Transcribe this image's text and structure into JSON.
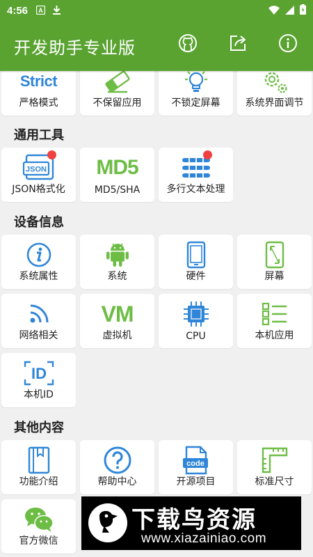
{
  "status_bar": {
    "time": "4:56",
    "left_icons": [
      "font-icon",
      "download-icon"
    ],
    "right_icons": [
      "wifi-icon",
      "signal-icon",
      "battery-icon"
    ]
  },
  "app_bar": {
    "title": "开发助手专业版",
    "actions": [
      "github-icon",
      "share-icon",
      "info-icon"
    ]
  },
  "top_row": {
    "items": [
      {
        "label": "严格模式",
        "icon_text": "Strict"
      },
      {
        "label": "不保留应用",
        "icon": "eraser-icon"
      },
      {
        "label": "不锁定屏幕",
        "icon": "bulb-icon"
      },
      {
        "label": "系统界面调节",
        "icon": "gears-icon"
      }
    ]
  },
  "general_tools": {
    "title": "通用工具",
    "items": [
      {
        "label": "JSON格式化",
        "icon_text": "JSON"
      },
      {
        "label": "MD5/SHA",
        "icon_text": "MD5"
      },
      {
        "label": "多行文本处理",
        "icon": "multiline-text-icon"
      }
    ]
  },
  "device_info": {
    "title": "设备信息",
    "items": [
      {
        "label": "系统属性",
        "icon": "info-circle-icon"
      },
      {
        "label": "系统",
        "icon": "android-icon"
      },
      {
        "label": "硬件",
        "icon": "phone-icon"
      },
      {
        "label": "屏幕",
        "icon": "screen-icon"
      },
      {
        "label": "网络相关",
        "icon": "wifi-signal-icon"
      },
      {
        "label": "虚拟机",
        "icon_text": "VM"
      },
      {
        "label": "CPU",
        "icon": "chip-icon"
      },
      {
        "label": "本机应用",
        "icon": "app-list-icon"
      },
      {
        "label": "本机ID",
        "icon_text": "ID"
      }
    ]
  },
  "other": {
    "title": "其他内容",
    "items": [
      {
        "label": "功能介绍",
        "icon": "book-icon"
      },
      {
        "label": "帮助中心",
        "icon": "help-icon"
      },
      {
        "label": "开源项目",
        "icon_text": "code"
      },
      {
        "label": "标准尺寸",
        "icon": "ruler-icon"
      },
      {
        "label": "官方微信",
        "icon": "wechat-icon"
      }
    ]
  },
  "watermark": {
    "title": "下载鸟资源",
    "url": "www.xiazainiao.com"
  },
  "colors": {
    "primary": "#5aa331",
    "blue": "#2f86d8",
    "green": "#6dbd45",
    "badge": "#f04141",
    "background": "#f0f0f0"
  }
}
